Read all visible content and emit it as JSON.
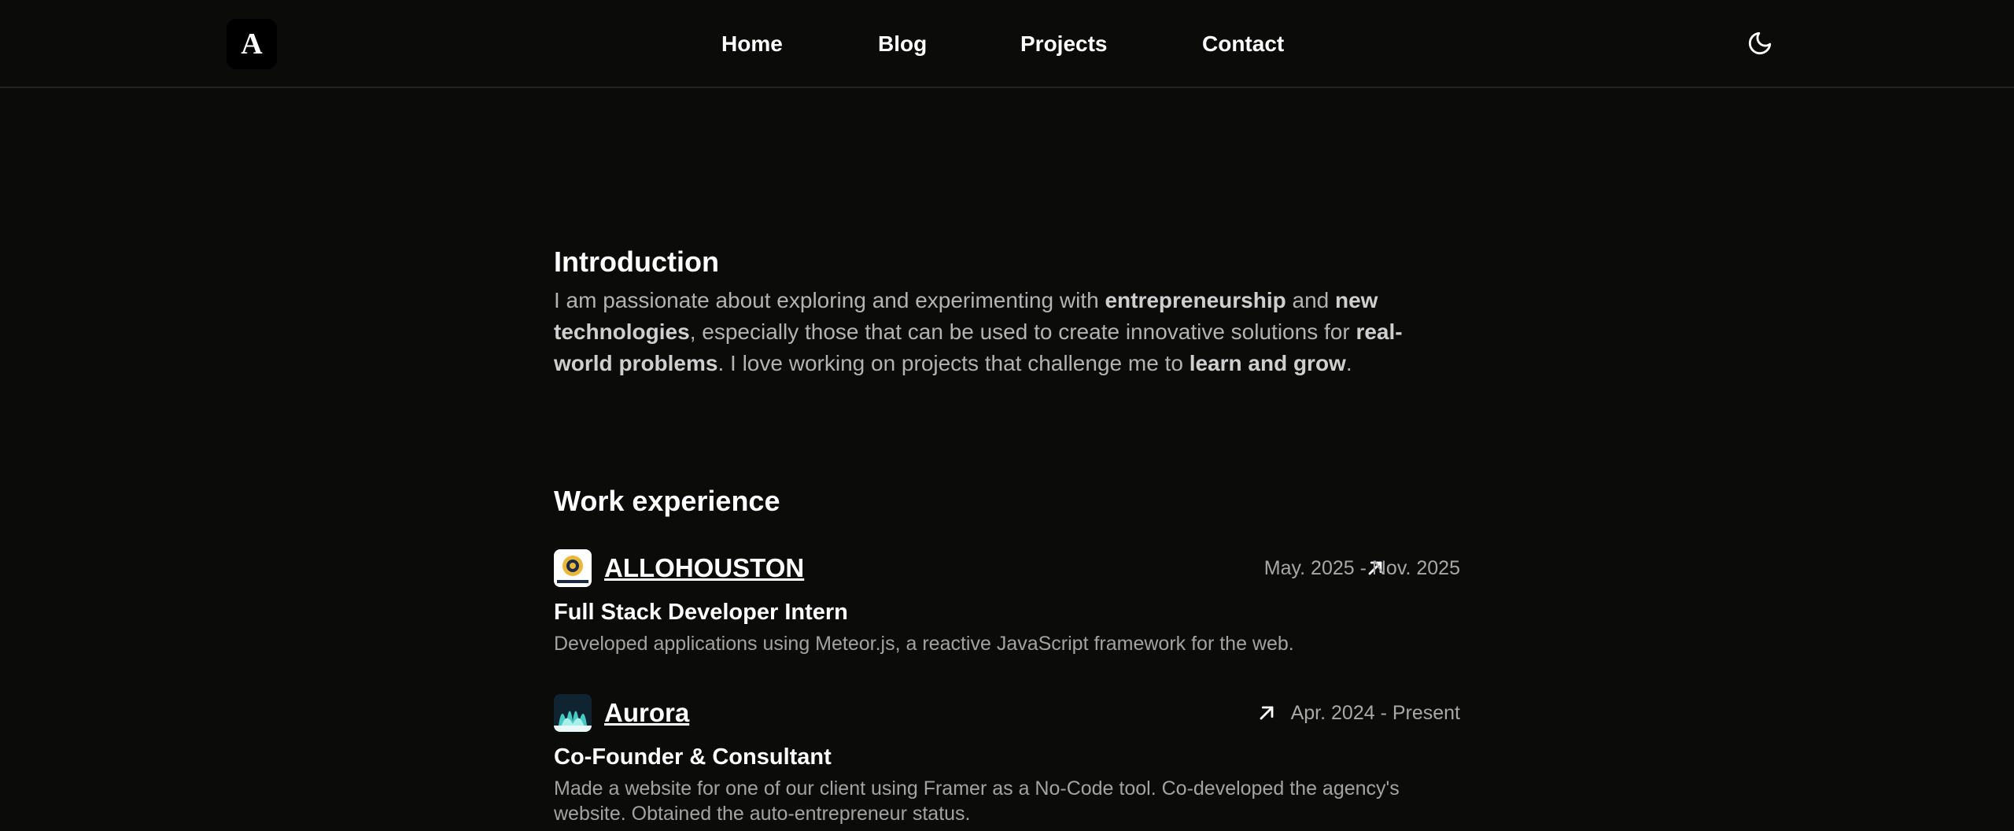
{
  "header": {
    "logo_text": "A",
    "nav": [
      {
        "label": "Home"
      },
      {
        "label": "Blog"
      },
      {
        "label": "Projects"
      },
      {
        "label": "Contact"
      }
    ],
    "theme_toggle_icon": "moon-icon"
  },
  "intro": {
    "title": "Introduction",
    "segments": [
      "I am passionate about exploring and experimenting with ",
      "entrepreneurship",
      " and ",
      "new technologies",
      ", especially those that can be used to create innovative solutions for ",
      "real-world problems",
      ". I love working on projects that challenge me to ",
      "learn and grow",
      "."
    ]
  },
  "work": {
    "title": "Work experience",
    "jobs": [
      {
        "company": "ALLOHOUSTON",
        "logo_icon": "allohouston-logo-icon",
        "dates": "May. 2025 - Nov. 2025",
        "role": "Full Stack Developer Intern",
        "description": "Developed applications using Meteor.js, a reactive JavaScript framework for the web."
      },
      {
        "company": "Aurora",
        "logo_icon": "aurora-logo-icon",
        "dates": "Apr. 2024 - Present",
        "role": "Co-Founder & Consultant",
        "description": "Made a website for one of our client using Framer as a No-Code tool. Co-developed the agency's website. Obtained the auto-entrepreneur status."
      }
    ]
  },
  "colors": {
    "background": "#0b0b0a",
    "text": "#ffffff",
    "muted": "#a3a3a3",
    "divider": "#232322"
  }
}
